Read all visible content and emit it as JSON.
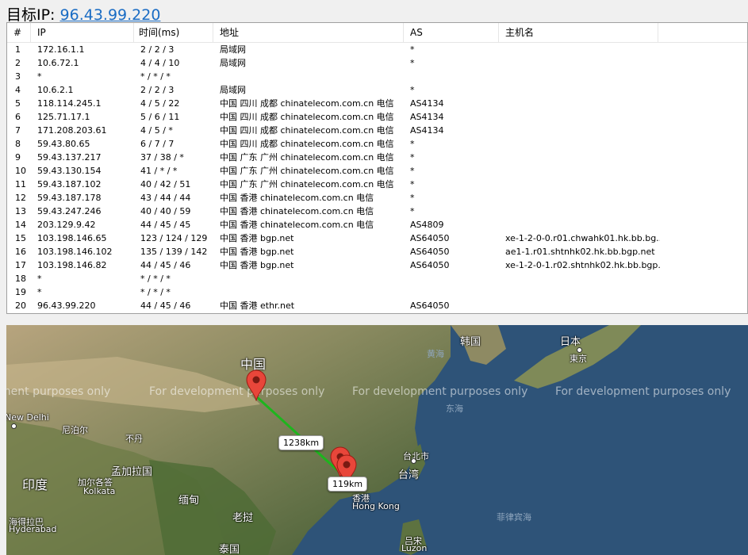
{
  "header": {
    "label": "目标IP:",
    "ip": "96.43.99.220"
  },
  "table": {
    "columns": [
      "#",
      "IP",
      "时间(ms)",
      "地址",
      "AS",
      "主机名"
    ],
    "rows": [
      [
        "1",
        "172.16.1.1",
        "2 / 2 / 3",
        "局域网",
        "*",
        ""
      ],
      [
        "2",
        "10.6.72.1",
        "4 / 4 / 10",
        "局域网",
        "*",
        ""
      ],
      [
        "3",
        "*",
        "* / * / *",
        "",
        "",
        ""
      ],
      [
        "4",
        "10.6.2.1",
        "2 / 2 / 3",
        "局域网",
        "*",
        ""
      ],
      [
        "5",
        "118.114.245.1",
        "4 / 5 / 22",
        "中国 四川 成都 chinatelecom.com.cn 电信",
        "AS4134",
        ""
      ],
      [
        "6",
        "125.71.17.1",
        "5 / 6 / 11",
        "中国 四川 成都 chinatelecom.com.cn 电信",
        "AS4134",
        ""
      ],
      [
        "7",
        "171.208.203.61",
        "4 / 5 / *",
        "中国 四川 成都 chinatelecom.com.cn 电信",
        "AS4134",
        ""
      ],
      [
        "8",
        "59.43.80.65",
        "6 / 7 / 7",
        "中国 四川 成都 chinatelecom.com.cn 电信",
        "*",
        ""
      ],
      [
        "9",
        "59.43.137.217",
        "37 / 38 / *",
        "中国 广东 广州 chinatelecom.com.cn 电信",
        "*",
        ""
      ],
      [
        "10",
        "59.43.130.154",
        "41 / * / *",
        "中国 广东 广州 chinatelecom.com.cn 电信",
        "*",
        ""
      ],
      [
        "11",
        "59.43.187.102",
        "40 / 42 / 51",
        "中国 广东 广州 chinatelecom.com.cn 电信",
        "*",
        ""
      ],
      [
        "12",
        "59.43.187.178",
        "43 / 44 / 44",
        "中国 香港 chinatelecom.com.cn 电信",
        "*",
        ""
      ],
      [
        "13",
        "59.43.247.246",
        "40 / 40 / 59",
        "中国 香港 chinatelecom.com.cn 电信",
        "*",
        ""
      ],
      [
        "14",
        "203.129.9.42",
        "44 / 45 / 45",
        "中国 香港 chinatelecom.com.cn 电信",
        "AS4809",
        ""
      ],
      [
        "15",
        "103.198.146.65",
        "123 / 124 / 129",
        "中国 香港 bgp.net",
        "AS64050",
        "xe-1-2-0-0.r01.chwahk01.hk.bb.bg..."
      ],
      [
        "16",
        "103.198.146.102",
        "135 / 139 / 142",
        "中国 香港 bgp.net",
        "AS64050",
        "ae1-1.r01.shtnhk02.hk.bb.bgp.net"
      ],
      [
        "17",
        "103.198.146.82",
        "44 / 45 / 46",
        "中国 香港 bgp.net",
        "AS64050",
        "xe-1-2-0-1.r02.shtnhk02.hk.bb.bgp..."
      ],
      [
        "18",
        "*",
        "* / * / *",
        "",
        "",
        ""
      ],
      [
        "19",
        "*",
        "* / * / *",
        "",
        "",
        ""
      ],
      [
        "20",
        "96.43.99.220",
        "44 / 45 / 46",
        "中国 香港 ethr.net",
        "AS64050",
        ""
      ]
    ]
  },
  "map": {
    "watermark": "For development purposes only",
    "watermark_partial": "ment purposes only",
    "distances": [
      "1238km",
      "119km"
    ],
    "labels": {
      "china": "中国",
      "korea": "韩国",
      "japan": "日本",
      "tokyo": "東京",
      "yellow_sea": "黄海",
      "east_sea": "东海",
      "newdelhi": "New Delhi",
      "nepal": "尼泊尔",
      "bhutan": "不丹",
      "bangladesh": "孟加拉国",
      "india": "印度",
      "kolkata_cn": "加尔各答",
      "kolkata": "Kolkata",
      "myanmar": "缅甸",
      "laos": "老挝",
      "thailand": "泰国",
      "taipei": "台北市",
      "taiwan": "台湾",
      "hk_cn": "香港",
      "hk": "Hong Kong",
      "philippine_sea": "菲律宾海",
      "luzon_cn": "吕宋",
      "luzon": "Luzon",
      "hyderabad_cn": "海得拉巴",
      "hyderabad": "Hyderabad"
    }
  }
}
